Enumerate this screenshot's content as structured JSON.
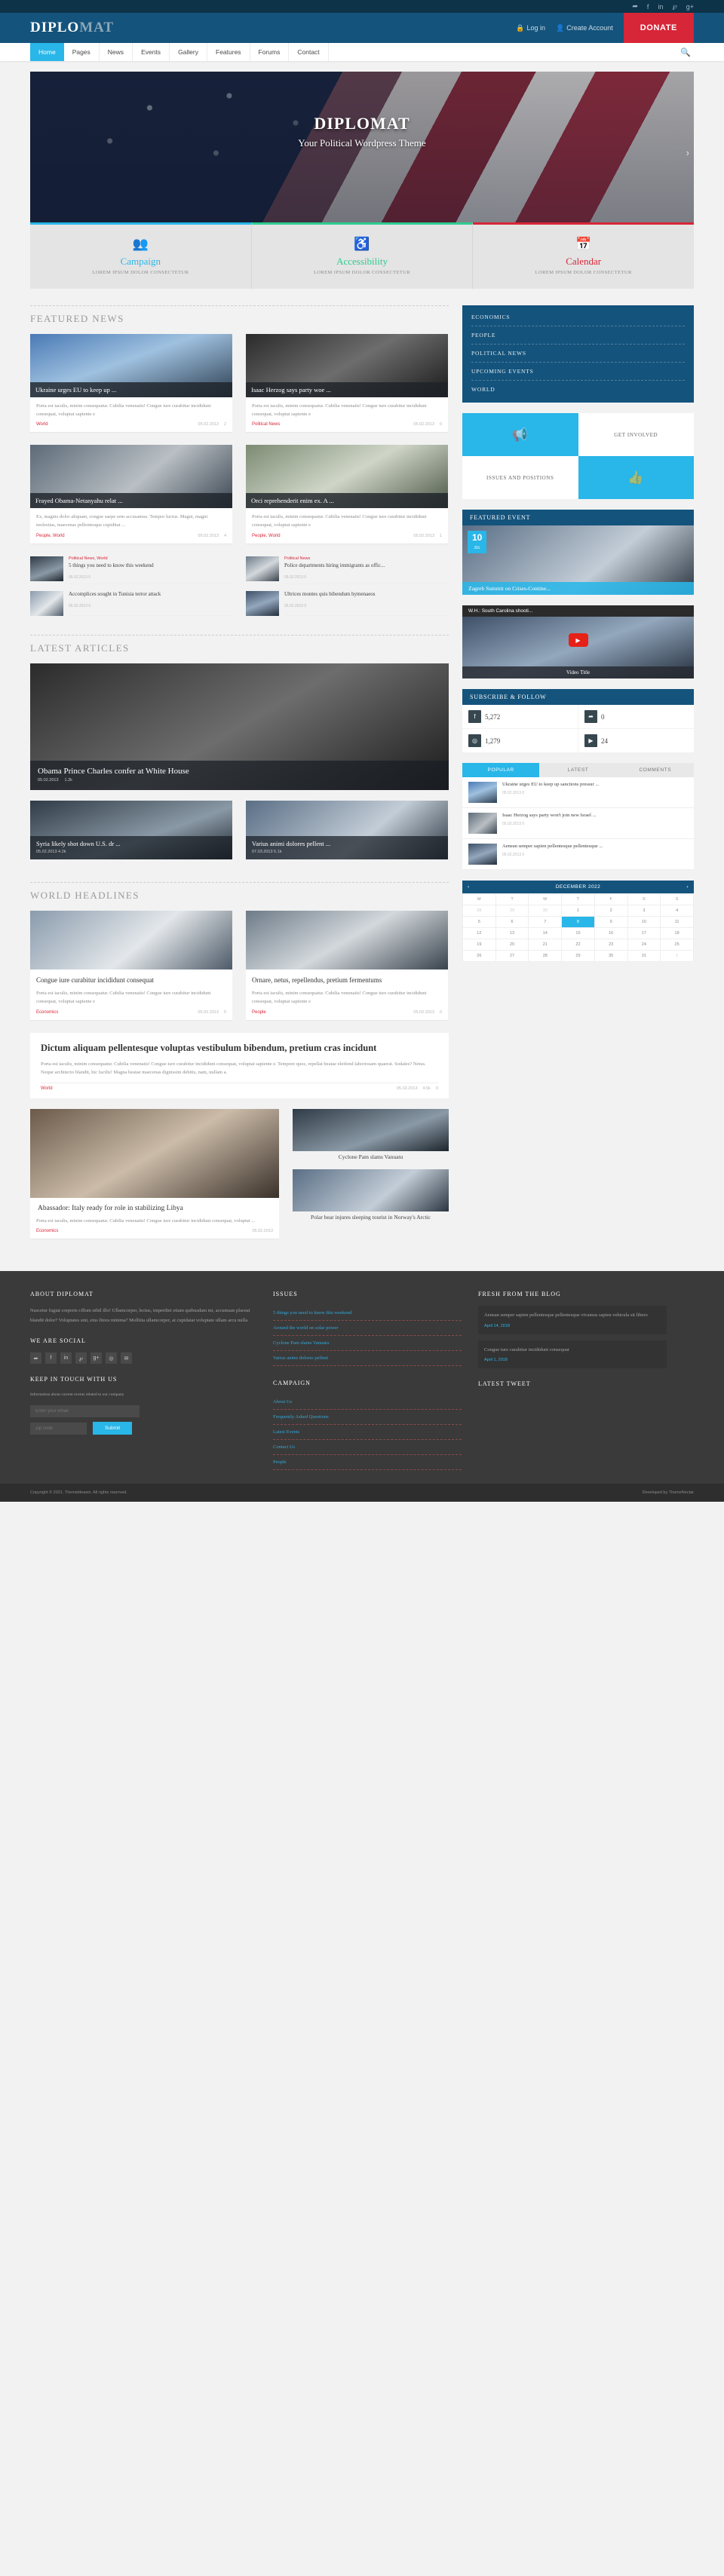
{
  "topbar": {
    "social": [
      "twitter-icon",
      "facebook-icon",
      "linkedin-icon",
      "pinterest-icon",
      "googleplus-icon"
    ]
  },
  "header": {
    "logo_main": "DIPLO",
    "logo_alt": "MAT",
    "login": "Log in",
    "create_account": "Create Account",
    "donate": "DONATE"
  },
  "nav": {
    "items": [
      "Home",
      "Pages",
      "News",
      "Events",
      "Gallery",
      "Features",
      "Forums",
      "Contact"
    ],
    "active": "Home"
  },
  "slider": {
    "title": "DIPLOMAT",
    "subtitle": "Your Political Wordpress Theme"
  },
  "promos": [
    {
      "icon": "users-icon",
      "title": "Campaign",
      "sub": "LOREM IPSUM DOLOR CONSECTETUR",
      "color": "#29b6e8"
    },
    {
      "icon": "wheelchair-icon",
      "title": "Accessibility",
      "sub": "LOREM IPSUM DOLOR CONSECTETUR",
      "color": "#2ecc8f"
    },
    {
      "icon": "calendar-icon",
      "title": "Calendar",
      "sub": "LOREM IPSUM DOLOR CONSECTETUR",
      "color": "#d72638"
    }
  ],
  "sections": {
    "featured_news": "FEATURED NEWS",
    "latest_articles": "LATEST ARTICLES",
    "world_headlines": "WORLD HEADLINES"
  },
  "body_text": "Porta est iaculis, minim consequatur. Cubilia venenatis! Congue iure curabitur incididunt consequat, voluptat sapiente e",
  "featured": [
    {
      "title": "Ukraine urges EU to keep up ...",
      "cat": "World",
      "date": "05.02.2013",
      "comments": "2",
      "img": "im1"
    },
    {
      "title": "Isaac Herzog says party woe ...",
      "cat": "Political News",
      "date": "05.02.2013",
      "comments": "0",
      "img": "im2"
    },
    {
      "title": "Frayed Obama-Netanyahu relat ...",
      "cat": "People, World",
      "date": "05.02.2013",
      "comments": "4",
      "img": "im3"
    },
    {
      "title": "Orci reprehenderit enim ex. A ...",
      "cat": "People, World",
      "date": "05.02.2013",
      "comments": "1",
      "img": "im4"
    }
  ],
  "featured_caption_2": "Ex, magnis dolor aliquam, congue saepe sem accusamus. Tempor luctus. Magni, magni molestias, maecenas pellentesque cupiditat ...",
  "featured_list": [
    {
      "cat": "Political News, World",
      "title": "5 things you need to know this weekend",
      "meta": "05.02.2013   0",
      "img": "im5"
    },
    {
      "cat": "Political News",
      "title": "Police departments hiring immigrants as offic...",
      "meta": "05.02.2013   0",
      "img": "im6"
    },
    {
      "cat": "",
      "title": "Accomplices sought in Tunisia terror attack",
      "meta": "05.02.2013   0",
      "img": "im7"
    },
    {
      "cat": "",
      "title": "Ultrices montes quis bibendum hymenaeos",
      "meta": "05.02.2013   0",
      "img": "im8"
    }
  ],
  "latest": {
    "main": {
      "title": "Obama Prince Charles confer at White House",
      "date": "05.02.2013",
      "views": "1.2k",
      "img": "im2"
    },
    "small": [
      {
        "title": "Syria likely shot down U.S. dr ...",
        "meta": "05.02.2013   4.2k",
        "img": "im5"
      },
      {
        "title": "Varius animi dolores pellent ...",
        "meta": "07.03.2013   5.1k",
        "img": "im9"
      }
    ]
  },
  "world": [
    {
      "title": "Congue iure curabitur incididunt consequat",
      "cat": "Economics",
      "date": "05.02.2013",
      "comments": "0",
      "img": "im7"
    },
    {
      "title": "Ornare, netus, repellendus, pretium fermentums",
      "cat": "People",
      "date": "05.02.2013",
      "comments": "0",
      "img": "im6"
    }
  ],
  "world_feature": {
    "title": "Dictum aliquam pellentesque voluptas vestibulum bibendum, pretium cras incidunt",
    "body": "Porta est iaculis, minim consequatur. Cubilia venenatis! Congue iure curabitur incididunt consequat, voluptat sapiente e. Tempore quos, repellat beatae eleifend laboriosam quaerat. Sodales? Netus. Neque architecto blandit, hic facilis! Magna beatae maecenas dignissim debitis, nam, nullam a.",
    "cat": "World",
    "date": "05.02.2013",
    "views": "4.5k",
    "comments": "0"
  },
  "bottom_posts": {
    "main": {
      "title": "Abassador: Italy ready for role in stabilizing Libya",
      "body": "Porta est iaculis, minim consequatur. Cubilia venenatis! Congue iure curabitur incididunt consequat, voluptat ...",
      "cat": "Economics",
      "img": "im10"
    },
    "side": [
      {
        "title": "Cyclone Pam slams Vanuatu",
        "img": "im5"
      },
      {
        "title": "Polar bear injures sleeping tourist in Norway's Arctic",
        "img": "im9"
      }
    ]
  },
  "sidebar": {
    "categories": [
      "ECONOMICS",
      "PEOPLE",
      "POLITICAL NEWS",
      "UPCOMING EVENTS",
      "WORLD"
    ],
    "boxes": [
      {
        "type": "icon",
        "icon": "megaphone-icon"
      },
      {
        "type": "text",
        "label": "GET INVOLVED"
      },
      {
        "type": "text",
        "label": "ISSUES AND POSITIONS"
      },
      {
        "type": "icon",
        "icon": "thumbs-up-icon"
      }
    ],
    "featured_event": {
      "widget_title": "FEATURED EVENT",
      "day": "10",
      "month": "JUL",
      "title": "Zagreb Summit on Crises-Contine..."
    },
    "video": {
      "label": "W.H.: South Carolina shooti...",
      "caption": "Video Title"
    },
    "subscribe": {
      "widget_title": "SUBSCRIBE & FOLLOW",
      "items": [
        {
          "icon": "facebook-icon",
          "count": "5,272"
        },
        {
          "icon": "twitter-icon",
          "count": "0"
        },
        {
          "icon": "rss-icon",
          "count": "1,279"
        },
        {
          "icon": "youtube-icon",
          "count": "24"
        }
      ]
    },
    "tabs": [
      "POPULAR",
      "LATEST",
      "COMMENTS"
    ],
    "tab_active": "POPULAR",
    "popular": [
      {
        "title": "Ukraine urges EU to keep up sanctions pressur ...",
        "meta": "05.02.2013   0",
        "img": "im1"
      },
      {
        "title": "Isaac Herzog says party won't join new Israel ...",
        "meta": "05.02.2013   0",
        "img": "im3"
      },
      {
        "title": "Aenean semper sapien pellentesque pellentesque ...",
        "meta": "05.02.2013   0",
        "img": "im8"
      }
    ],
    "calendar": {
      "month": "DECEMBER 2022",
      "prev": "‹",
      "next": "›",
      "weekdays": [
        "M",
        "T",
        "W",
        "T",
        "F",
        "S",
        "S"
      ],
      "weeks": [
        [
          {
            "d": "28",
            "m": true
          },
          {
            "d": "29",
            "m": true
          },
          {
            "d": "30",
            "m": true
          },
          {
            "d": "1"
          },
          {
            "d": "2"
          },
          {
            "d": "3"
          },
          {
            "d": "4"
          }
        ],
        [
          {
            "d": "5"
          },
          {
            "d": "6"
          },
          {
            "d": "7"
          },
          {
            "d": "8",
            "s": true
          },
          {
            "d": "9"
          },
          {
            "d": "10"
          },
          {
            "d": "11"
          }
        ],
        [
          {
            "d": "12"
          },
          {
            "d": "13"
          },
          {
            "d": "14"
          },
          {
            "d": "15"
          },
          {
            "d": "16"
          },
          {
            "d": "17"
          },
          {
            "d": "18"
          }
        ],
        [
          {
            "d": "19"
          },
          {
            "d": "20"
          },
          {
            "d": "21"
          },
          {
            "d": "22"
          },
          {
            "d": "23"
          },
          {
            "d": "24"
          },
          {
            "d": "25"
          }
        ],
        [
          {
            "d": "26"
          },
          {
            "d": "27"
          },
          {
            "d": "28"
          },
          {
            "d": "29"
          },
          {
            "d": "30"
          },
          {
            "d": "31"
          },
          {
            "d": "1",
            "m": true
          }
        ]
      ]
    }
  },
  "footer": {
    "about_title": "ABOUT DIPLOMAT",
    "about_text": "Nascetur fugiat corporis cillum nihil illo! Ullamcorper, lectus, imperdiet etiam quibusdam mi, accumsan placeat blandit dolor? Voluptates sint, eius litora minima? Mollitia ullamcorper, at cupidatat voluptate ullam arcu nulla.",
    "social_title": "WE ARE SOCIAL",
    "social": [
      "twitter-icon",
      "facebook-icon",
      "linkedin-icon",
      "pinterest-icon",
      "googleplus-icon",
      "rss-icon",
      "mail-icon"
    ],
    "touch_title": "KEEP IN TOUCH WITH US",
    "touch_sub": "Information about current events related to our company",
    "email_placeholder": "Enter your email",
    "zip_placeholder": "Zip code",
    "submit": "Submit",
    "issues_title": "ISSUES",
    "issues": [
      "5 things you need to know this weekend",
      "Around the world on solar power",
      "Cyclone Pam slams Vanuatu",
      "Varius animi dolores pellent"
    ],
    "campaign_title": "CAMPAIGN",
    "campaign": [
      "About Us",
      "Frequently Asked Questions",
      "Latest Events",
      "Contact Us",
      "People"
    ],
    "blog_title": "FRESH FROM THE BLOG",
    "blog": [
      {
        "text": "Aenean semper sapien pellentesque pellentesque vivamus sapien vehicula sit libero",
        "date": "April 14, 2018"
      },
      {
        "text": "Congue iure curabitur incididunt consequat",
        "date": "April 1, 2018"
      }
    ],
    "tweet_title": "LATEST TWEET"
  },
  "bottombar": {
    "copyright": "Copyright © 2021. Themeldeawn. All rights reserved.",
    "credit": "Developed by ThemeNectar"
  }
}
